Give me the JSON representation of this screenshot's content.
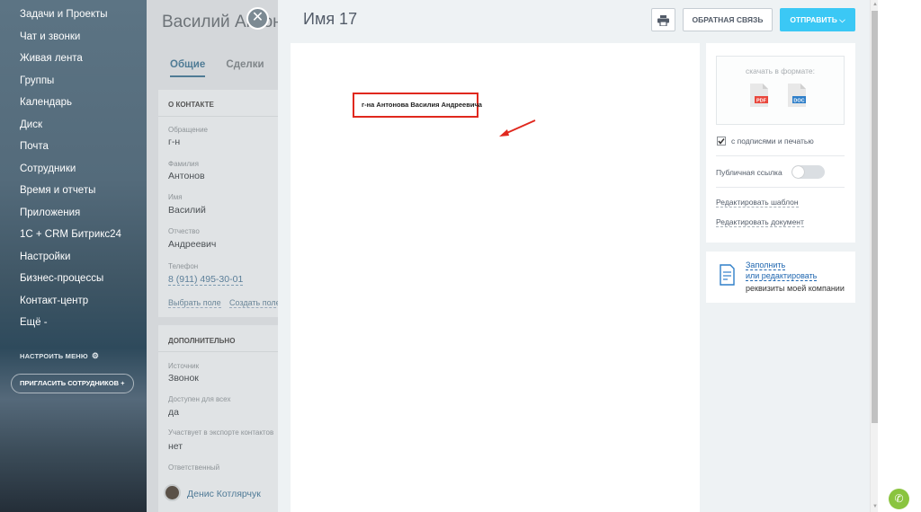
{
  "sidebar": {
    "items": [
      "Задачи и Проекты",
      "Чат и звонки",
      "Живая лента",
      "Группы",
      "Календарь",
      "Диск",
      "Почта",
      "Сотрудники",
      "Время и отчеты",
      "Приложения",
      "1С + CRM Битрикс24",
      "Настройки",
      "Бизнес-процессы",
      "Контакт-центр",
      "Ещё -"
    ],
    "setup_menu": "НАСТРОИТЬ МЕНЮ",
    "invite": "ПРИГЛАСИТЬ СОТРУДНИКОВ"
  },
  "contact": {
    "title": "Василий Антонов",
    "tabs": [
      "Общие",
      "Сделки"
    ],
    "section_about": "О КОНТАКТЕ",
    "fields": [
      {
        "label": "Обращение",
        "value": "г-н"
      },
      {
        "label": "Фамилия",
        "value": "Антонов"
      },
      {
        "label": "Имя",
        "value": "Василий"
      },
      {
        "label": "Отчество",
        "value": "Андреевич"
      },
      {
        "label": "Телефон",
        "value": "8 (911) 495-30-01"
      }
    ],
    "choose_field": "Выбрать поле",
    "create_field": "Создать поле",
    "section_extra": "ДОПОЛНИТЕЛЬНО",
    "extra": [
      {
        "label": "Источник",
        "value": "Звонок"
      },
      {
        "label": "Доступен для всех",
        "value": "да"
      },
      {
        "label": "Участвует в экспорте контактов",
        "value": "нет"
      },
      {
        "label": "Ответственный",
        "value": "Денис Котлярчук"
      }
    ]
  },
  "doc": {
    "title": "Имя 17",
    "feedback": "ОБРАТНАЯ СВЯЗЬ",
    "send": "ОТПРАВИТЬ",
    "addressee": "г-на Антонова Василия Андреевича"
  },
  "panel": {
    "download_caption": "скачать в формате:",
    "formats": [
      "PDF",
      "DOC"
    ],
    "signatures": "с подписями и печатью",
    "signatures_checked": true,
    "public_link": "Публичная ссылка",
    "public_link_on": false,
    "edit_template": "Редактировать шаблон",
    "edit_document": "Редактировать документ"
  },
  "requisites": {
    "line1": "Заполнить",
    "line2": "или редактировать",
    "line3": "реквизиты моей компании"
  },
  "colors": {
    "accent": "#3bc8f5",
    "highlight": "#e0281e",
    "link": "#2067b0",
    "call": "#8ac43f"
  }
}
